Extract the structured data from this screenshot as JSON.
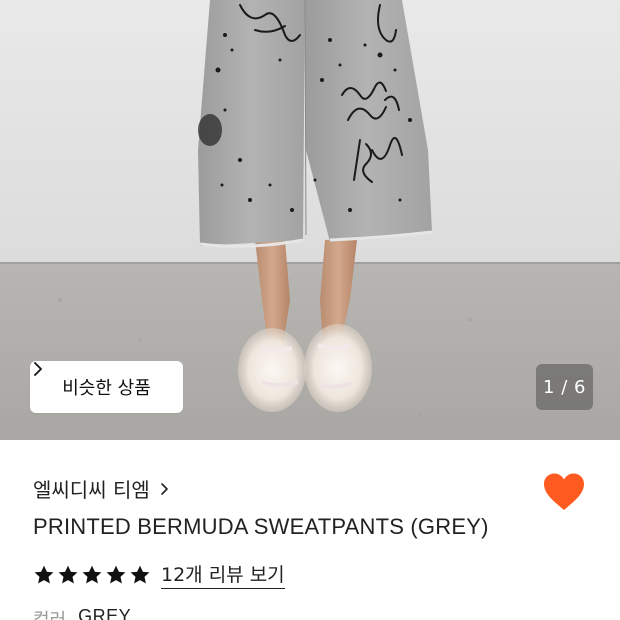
{
  "gallery": {
    "similar_button_label": "비슷한 상품",
    "counter": "1 / 6"
  },
  "product": {
    "brand": "엘씨디씨 티엠",
    "name": "PRINTED BERMUDA SWEATPANTS (GREY)",
    "rating_stars": 5,
    "review_link": "12개 리뷰 보기",
    "color_label": "컬러",
    "color_value": "GREY"
  },
  "colors": {
    "heart": "#FF5A1F",
    "star": "#111111"
  },
  "icons": {
    "similar_chevron": "chevron-right-icon",
    "brand_chevron": "chevron-right-icon",
    "wishlist": "heart-icon",
    "star": "star-icon"
  }
}
